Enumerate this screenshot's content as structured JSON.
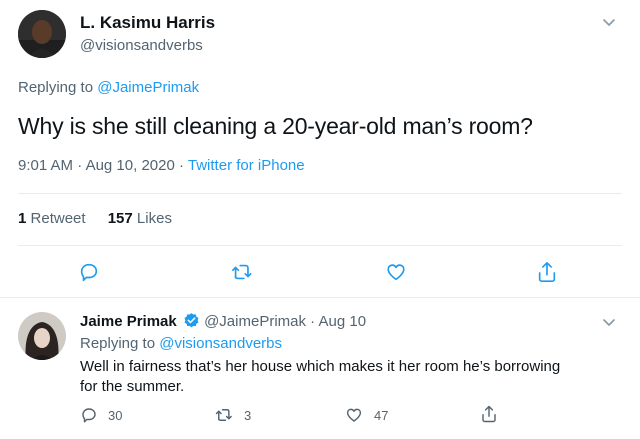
{
  "colors": {
    "accent": "#1d9bf0",
    "muted": "#536471",
    "text": "#0f1419",
    "divider": "#e6ecf0"
  },
  "main_tweet": {
    "author_name": "L. Kasimu Harris",
    "author_handle": "@visionsandverbs",
    "replying_label": "Replying to",
    "replying_to": "@JaimePrimak",
    "text": "Why is she still cleaning a 20-year-old man’s room?",
    "time": "9:01 AM",
    "sep1": "·",
    "date": "Aug 10, 2020",
    "sep2": "·",
    "source": "Twitter for iPhone",
    "stats": {
      "retweets": "1",
      "retweets_label": "Retweet",
      "likes": "157",
      "likes_label": "Likes"
    },
    "actions": [
      "reply-icon",
      "retweet-icon",
      "like-icon",
      "share-icon"
    ]
  },
  "reply_tweet": {
    "author_name": "Jaime Primak",
    "verified_icon": "verified-badge-icon",
    "author_handle": "@JaimePrimak",
    "sep": "·",
    "date": "Aug 10",
    "replying_label": "Replying to",
    "replying_to": "@visionsandverbs",
    "text_line1": "Well in fairness that’s her house which makes it her room he’s borrowing",
    "text_line2": "for the summer.",
    "reply_count": "30",
    "retweet_count": "3",
    "like_count": "47"
  }
}
